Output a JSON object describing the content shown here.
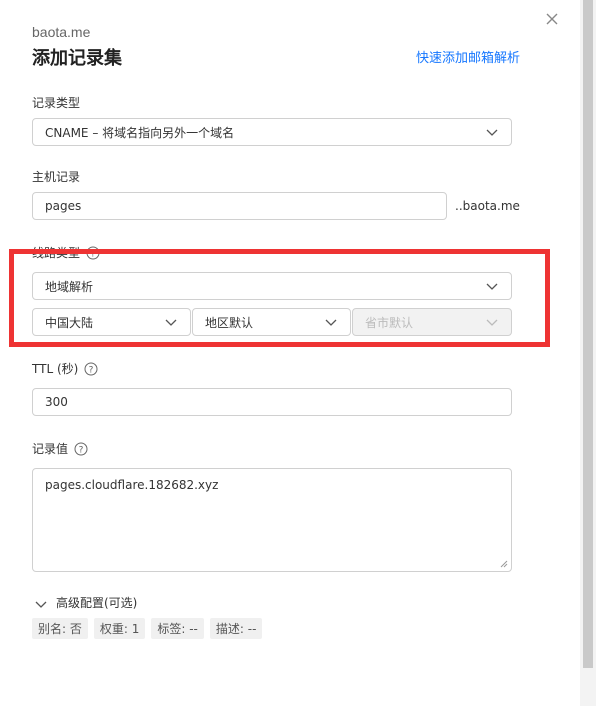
{
  "dialog": {
    "domain": "baota.me",
    "title": "添加记录集",
    "quick_link": "快速添加邮箱解析"
  },
  "record_type": {
    "label": "记录类型",
    "value": "CNAME – 将域名指向另外一个域名"
  },
  "host": {
    "label": "主机记录",
    "value": "pages",
    "suffix": "..baota.me"
  },
  "line_type": {
    "label": "线路类型",
    "value": "地域解析",
    "region": "中国大陆",
    "area": "地区默认",
    "province": "省市默认"
  },
  "ttl": {
    "label": "TTL (秒)",
    "value": "300"
  },
  "record_value": {
    "label": "记录值",
    "value": "pages.cloudflare.182682.xyz"
  },
  "advanced": {
    "label": "高级配置(可选)",
    "tags": [
      "别名: 否",
      "权重: 1",
      "标签: --",
      "描述: --"
    ]
  },
  "colors": {
    "accent": "#1677ff",
    "highlight": "#ee3333"
  }
}
